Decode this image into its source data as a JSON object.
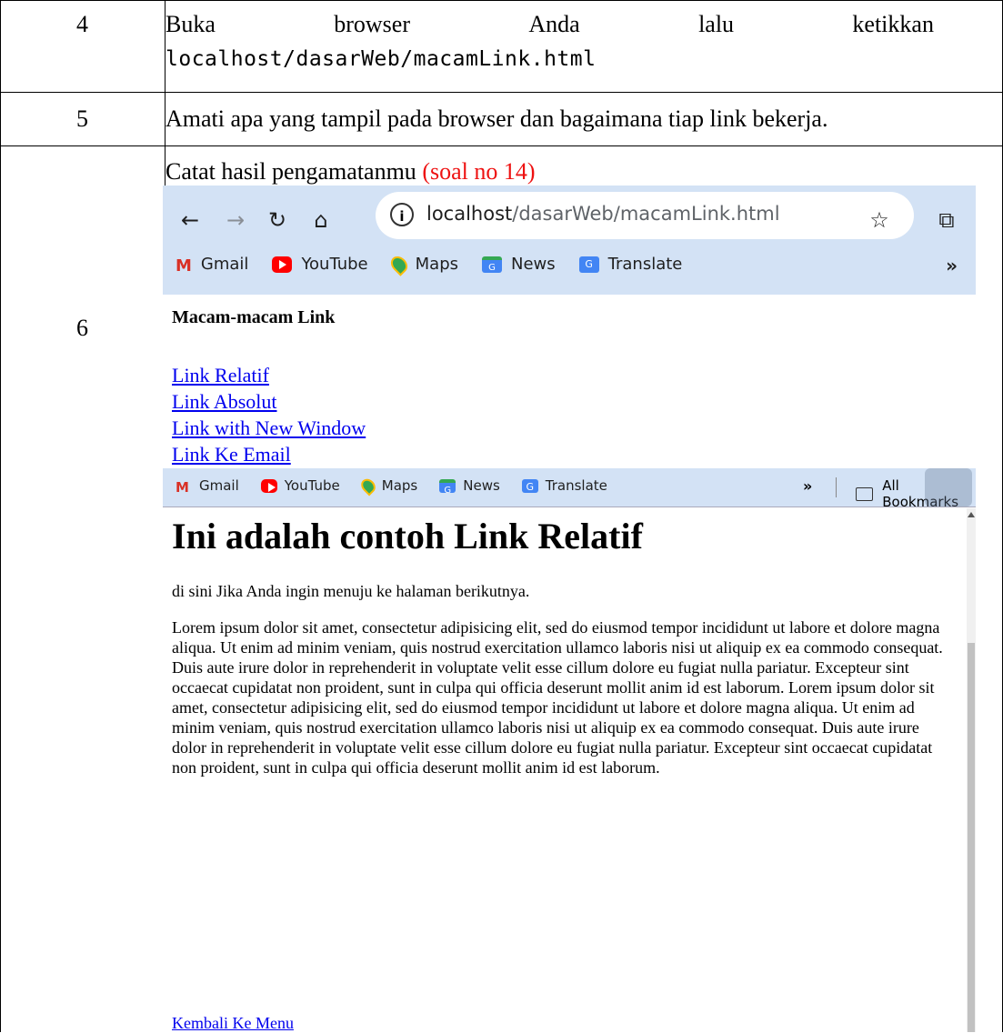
{
  "rows": [
    {
      "no": "4",
      "text_line1": [
        "Buka",
        "browser",
        "Anda",
        "lalu",
        "ketikkan"
      ],
      "text_line2": "localhost/dasarWeb/macamLink.html"
    },
    {
      "no": "5",
      "text": "Amati apa yang tampil pada browser dan bagaimana tiap link bekerja."
    },
    {
      "no": "6",
      "text": "Catat hasil pengamatanmu ",
      "text_red": "(soal no 14)"
    }
  ],
  "browser1": {
    "url_host": "localhost",
    "url_path": "/dasarWeb/macamLink.html",
    "bookmarks": [
      "Gmail",
      "YouTube",
      "Maps",
      "News",
      "Translate"
    ],
    "more": "»",
    "page_heading": "Macam-macam Link",
    "links": [
      "Link Relatif",
      "Link Absolut",
      "Link with New Window",
      "Link Ke Email"
    ]
  },
  "browser2": {
    "bookmarks": [
      "Gmail",
      "YouTube",
      "Maps",
      "News",
      "Translate"
    ],
    "more": "»",
    "all_bookmarks": "All Bookmarks",
    "heading": "Ini adalah contoh Link Relatif",
    "intro": "di sini Jika Anda ingin menuju ke halaman berikutnya.",
    "lorem": "Lorem ipsum dolor sit amet, consectetur adipisicing elit, sed do eiusmod tempor incididunt ut labore et dolore magna aliqua. Ut enim ad minim veniam, quis nostrud exercitation ullamco laboris nisi ut aliquip ex ea commodo consequat. Duis aute irure dolor in reprehenderit in voluptate velit esse cillum dolore eu fugiat nulla pariatur. Excepteur sint occaecat cupidatat non proident, sunt in culpa qui officia deserunt mollit anim id est laborum. Lorem ipsum dolor sit amet, consectetur adipisicing elit, sed do eiusmod tempor incididunt ut labore et dolore magna aliqua. Ut enim ad minim veniam, quis nostrud exercitation ullamco laboris nisi ut aliquip ex ea commodo consequat. Duis aute irure dolor in reprehenderit in voluptate velit esse cillum dolore eu fugiat nulla pariatur. Excepteur sint occaecat cupidatat non proident, sunt in culpa qui officia deserunt mollit anim id est laborum.",
    "back_link": "Kembali Ke Menu"
  },
  "colors": {
    "chrome_bg": "#d3e2f5",
    "link": "#0000ee",
    "red": "#ee1111"
  }
}
